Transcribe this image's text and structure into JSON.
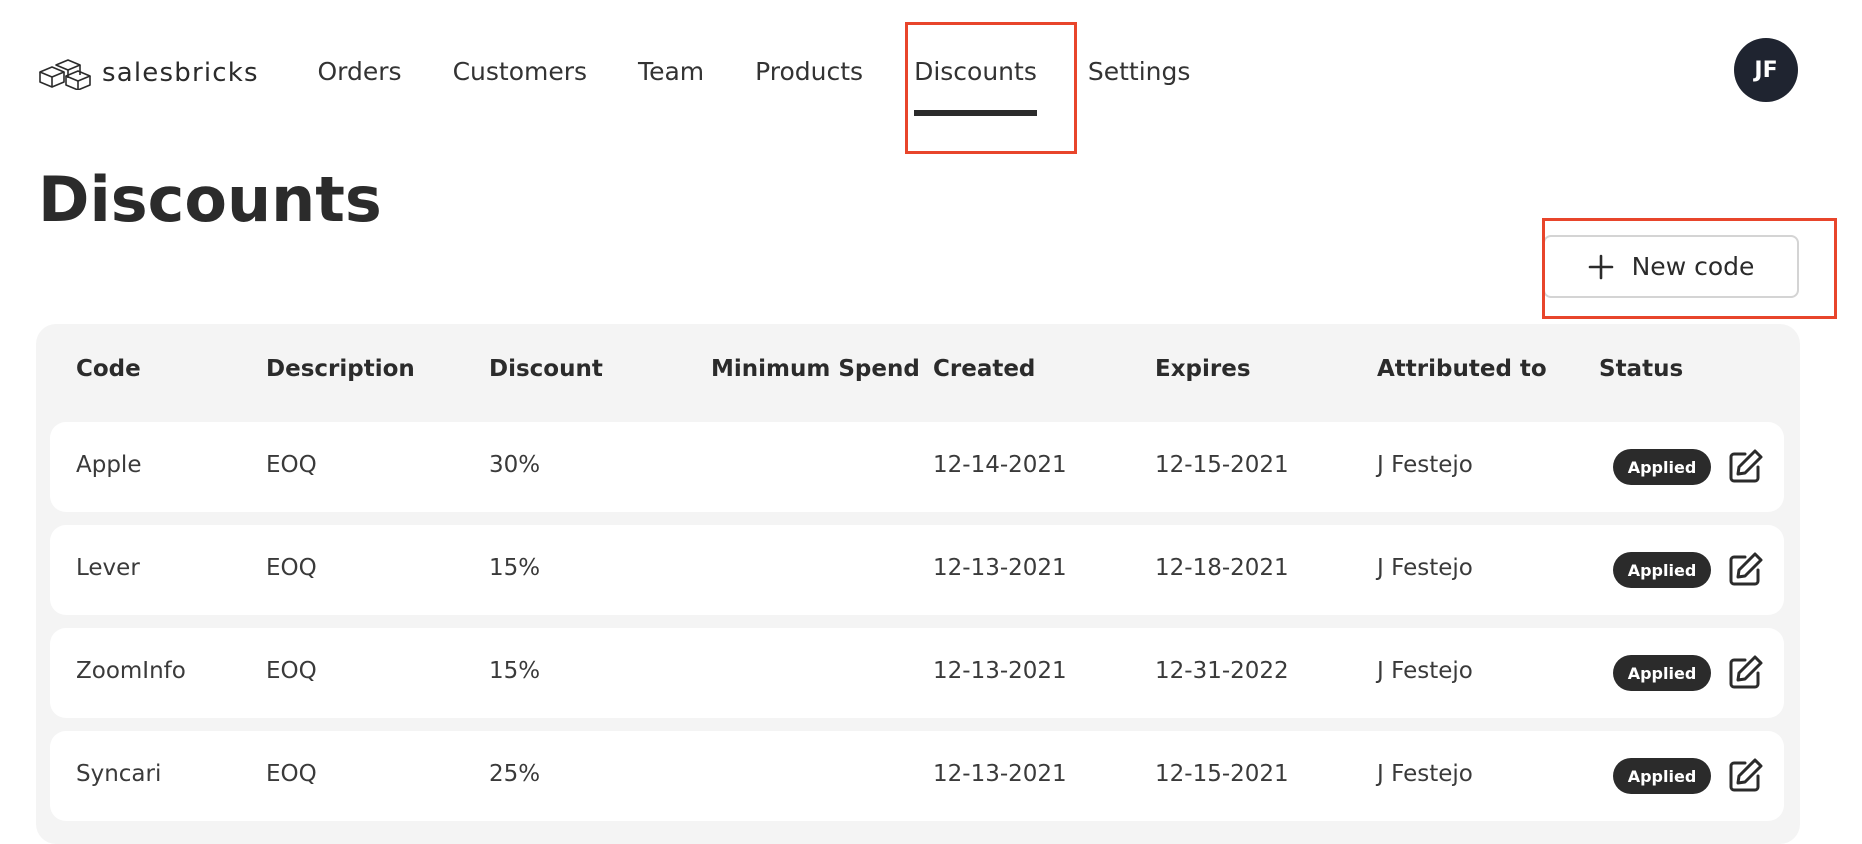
{
  "brand": {
    "name": "salesbricks"
  },
  "nav": {
    "items": [
      {
        "label": "Orders",
        "active": false
      },
      {
        "label": "Customers",
        "active": false
      },
      {
        "label": "Team",
        "active": false
      },
      {
        "label": "Products",
        "active": false
      },
      {
        "label": "Discounts",
        "active": true
      },
      {
        "label": "Settings",
        "active": false
      }
    ]
  },
  "user": {
    "initials": "JF"
  },
  "page": {
    "title": "Discounts"
  },
  "actions": {
    "new_code_label": "New code"
  },
  "table": {
    "columns": [
      "Code",
      "Description",
      "Discount",
      "Minimum Spend",
      "Created",
      "Expires",
      "Attributed to",
      "Status"
    ],
    "rows": [
      {
        "code": "Apple",
        "description": "EOQ",
        "discount": "30%",
        "minimum_spend": "",
        "created": "12-14-2021",
        "expires": "12-15-2021",
        "attributed_to": "J Festejo",
        "status": "Applied"
      },
      {
        "code": "Lever",
        "description": "EOQ",
        "discount": "15%",
        "minimum_spend": "",
        "created": "12-13-2021",
        "expires": "12-18-2021",
        "attributed_to": "J Festejo",
        "status": "Applied"
      },
      {
        "code": "ZoomInfo",
        "description": "EOQ",
        "discount": "15%",
        "minimum_spend": "",
        "created": "12-13-2021",
        "expires": "12-31-2022",
        "attributed_to": "J Festejo",
        "status": "Applied"
      },
      {
        "code": "Syncari",
        "description": "EOQ",
        "discount": "25%",
        "minimum_spend": "",
        "created": "12-13-2021",
        "expires": "12-15-2021",
        "attributed_to": "J Festejo",
        "status": "Applied"
      }
    ]
  },
  "icons": {
    "logo": "bricks-logo-icon",
    "add": "plus-icon",
    "edit": "edit-icon"
  },
  "colors": {
    "highlight": "#e8452b",
    "avatar_bg": "#1f2430",
    "badge_bg": "#2b2b2b",
    "panel_bg": "#f4f4f4"
  }
}
